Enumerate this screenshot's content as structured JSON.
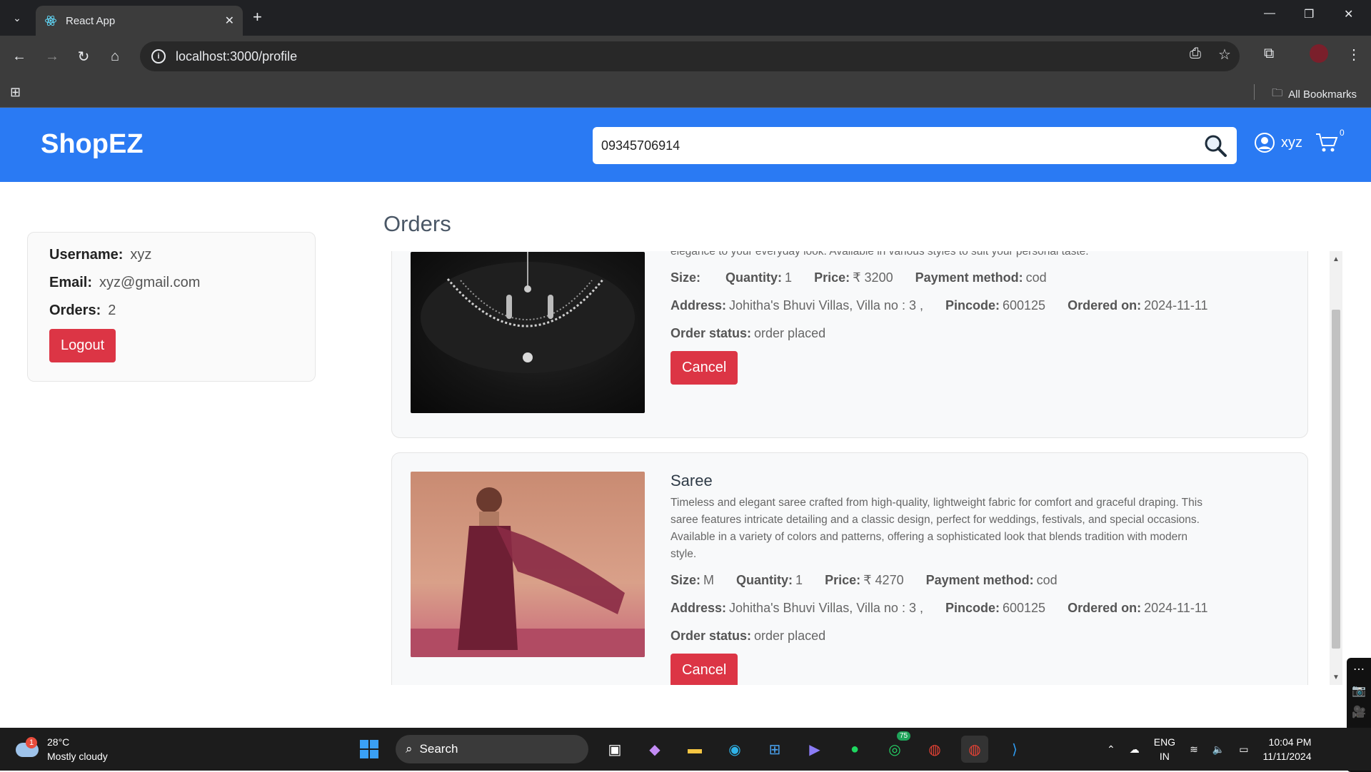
{
  "browser": {
    "tab_title": "React App",
    "url": "localhost:3000/profile",
    "bookmarks_label": "All Bookmarks"
  },
  "navbar": {
    "brand": "ShopEZ",
    "search_value": "09345706914",
    "username": "xyz",
    "cart_count": "0"
  },
  "profile": {
    "username_label": "Username:",
    "username_value": "xyz",
    "email_label": "Email:",
    "email_value": "xyz@gmail.com",
    "orders_label": "Orders:",
    "orders_value": "2",
    "logout_label": "Logout"
  },
  "orders_title": "Orders",
  "labels": {
    "size": "Size:",
    "quantity": "Quantity:",
    "price": "Price:",
    "payment": "Payment method:",
    "address": "Address:",
    "pincode": "Pincode:",
    "ordered_on": "Ordered on:",
    "status": "Order status:",
    "cancel": "Cancel"
  },
  "orders": [
    {
      "name": "",
      "description": "Elegant necklace crafted with high-quality materials, designed to add a touch of sophistication to any outfit. Featuring a beautiful arrangement of intricate details, this necklace is perfect for special occasions or adding elegance to your everyday look. Available in various styles to suit your personal taste.",
      "size": "",
      "quantity": "1",
      "price": "₹ 3200",
      "payment": "cod",
      "address": "Johitha's Bhuvi Villas, Villa no : 3 ,",
      "pincode": "600125",
      "ordered_on": "2024-11-11",
      "status": "order placed"
    },
    {
      "name": "Saree",
      "description": "Timeless and elegant saree crafted from high-quality, lightweight fabric for comfort and graceful draping. This saree features intricate detailing and a classic design, perfect for weddings, festivals, and special occasions. Available in a variety of colors and patterns, offering a sophisticated look that blends tradition with modern style.",
      "size": "M",
      "quantity": "1",
      "price": "₹ 4270",
      "payment": "cod",
      "address": "Johitha's Bhuvi Villas, Villa no : 3 ,",
      "pincode": "600125",
      "ordered_on": "2024-11-11",
      "status": "order placed"
    }
  ],
  "taskbar": {
    "temperature": "28°C",
    "weather": "Mostly cloudy",
    "weather_badge": "1",
    "search_label": "Search",
    "whatsapp_badge": "75",
    "lang": "ENG",
    "region": "IN",
    "time": "10:04 PM",
    "date": "11/11/2024"
  },
  "colors": {
    "brand_blue": "#2a7af3",
    "danger_red": "#dc3545"
  }
}
